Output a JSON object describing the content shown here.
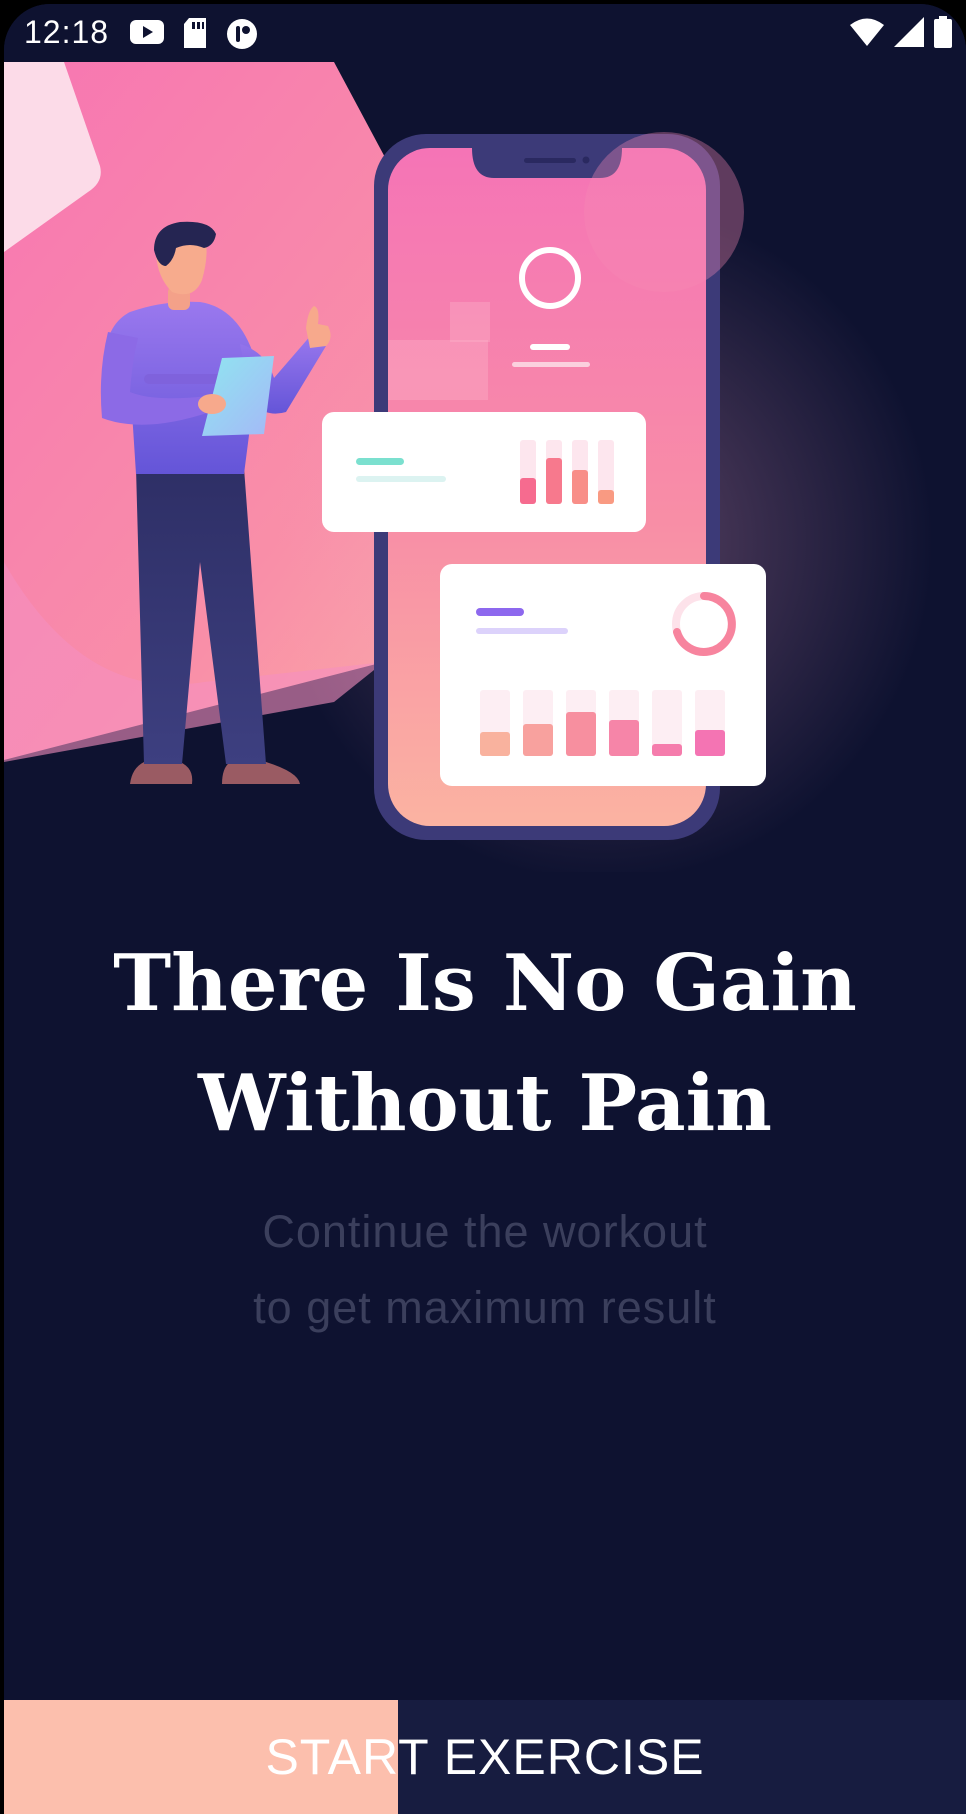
{
  "status_bar": {
    "time": "12:18",
    "left_icons": [
      "youtube-icon",
      "sd-card-icon",
      "app-notification-icon"
    ],
    "right_icons": [
      "wifi-icon",
      "signal-icon",
      "battery-icon"
    ]
  },
  "onboarding": {
    "title_line1": "There Is No Gain",
    "title_line2": "Without Pain",
    "subtitle_line1": "Continue the workout",
    "subtitle_line2": "to get maximum result"
  },
  "start_button": {
    "label": "START EXERCISE",
    "progress": 0.41
  },
  "colors": {
    "background": "#0e1230",
    "accent_peach": "#fcbfad",
    "accent_pink": "#f77db4",
    "button_bg": "#171c40"
  }
}
